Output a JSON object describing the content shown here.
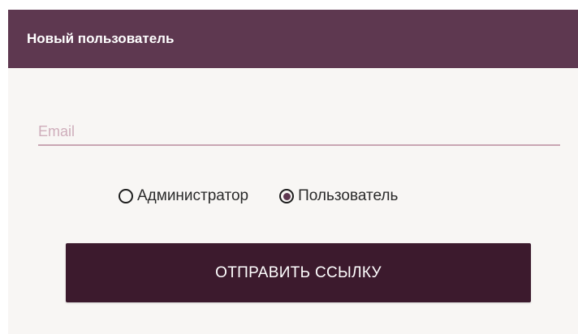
{
  "dialog": {
    "title": "Новый пользователь"
  },
  "email": {
    "placeholder": "Email",
    "value": ""
  },
  "roles": {
    "options": [
      {
        "label": "Администратор",
        "selected": false
      },
      {
        "label": "Пользователь",
        "selected": true
      }
    ]
  },
  "actions": {
    "submit_label": "ОТПРАВИТЬ ССЫЛКУ"
  },
  "colors": {
    "header_bg": "#5e3850",
    "button_bg": "#3c1a2d",
    "underline": "#c9a6b3",
    "panel_bg": "#f8f6f4"
  }
}
